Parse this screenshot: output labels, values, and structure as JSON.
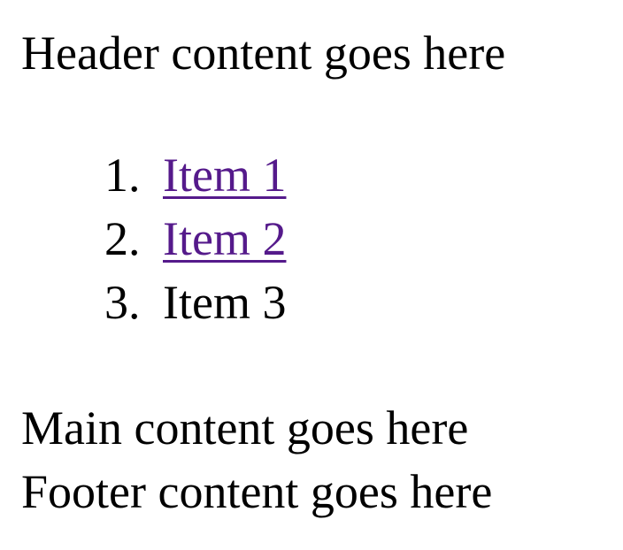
{
  "header": {
    "text": "Header content goes here"
  },
  "list": {
    "items": [
      {
        "marker": "1.",
        "label": "Item 1",
        "is_link": true,
        "color": "#551a8b"
      },
      {
        "marker": "2.",
        "label": "Item 2",
        "is_link": true,
        "color": "#551a8b"
      },
      {
        "marker": "3.",
        "label": "Item 3",
        "is_link": false
      }
    ]
  },
  "main": {
    "text": "Main content goes here"
  },
  "footer": {
    "text": "Footer content goes here"
  }
}
